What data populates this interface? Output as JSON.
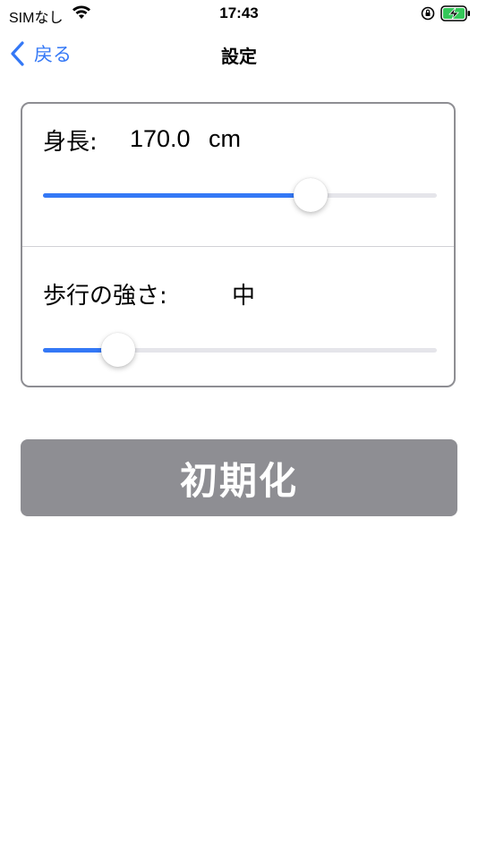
{
  "status_bar": {
    "carrier": "SIMなし",
    "time": "17:43",
    "icons": [
      "wifi-icon",
      "orientation-lock-icon",
      "battery-charging-icon"
    ],
    "battery_color": "#34c759"
  },
  "nav": {
    "back_label": "戻る",
    "title": "設定"
  },
  "settings": {
    "height": {
      "label": "身長:",
      "value": "170.0",
      "unit": "cm",
      "slider_fraction": 0.68
    },
    "walking_strength": {
      "label": "歩行の強さ:",
      "value": "中",
      "slider_fraction": 0.19
    }
  },
  "reset_button": {
    "label": "初期化"
  },
  "colors": {
    "accent": "#3478f6",
    "button_gray": "#8e8e93",
    "track": "#e5e5ea"
  }
}
